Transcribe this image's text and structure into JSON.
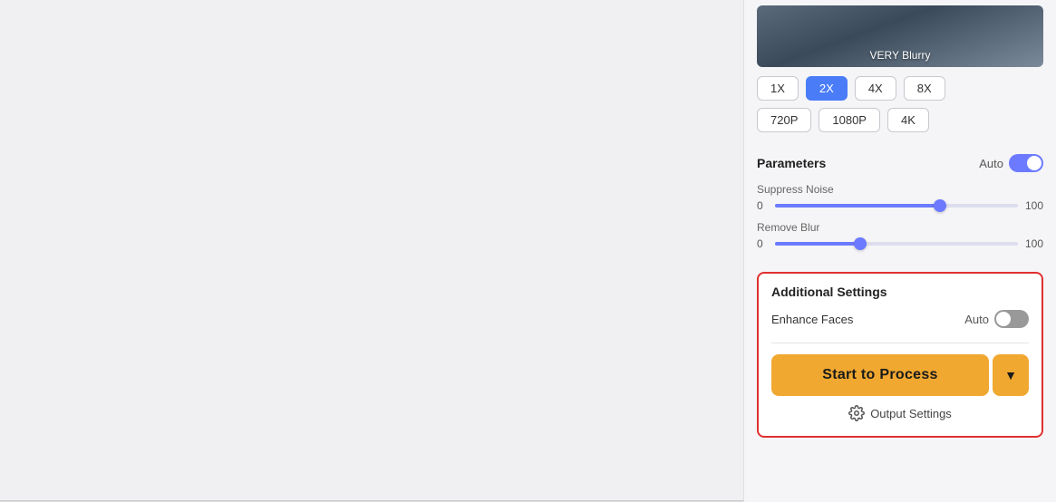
{
  "leftPanel": {
    "background": "#f0f0f2"
  },
  "rightPanel": {
    "imageThumb": {
      "label": "VERY Blurry"
    },
    "scaleButtons": {
      "row1": [
        "1X",
        "2X",
        "4X",
        "8X"
      ],
      "row2": [
        "720P",
        "1080P",
        "4K"
      ],
      "activeScale": "2X"
    },
    "parameters": {
      "title": "Parameters",
      "autoLabel": "Auto",
      "suppressNoise": {
        "label": "Suppress Noise",
        "min": 0,
        "max": 100,
        "value": 68,
        "fillPercent": 68
      },
      "removeBlur": {
        "label": "Remove Blur",
        "min": 0,
        "max": 100,
        "value": 35,
        "fillPercent": 35
      }
    },
    "additionalSettings": {
      "title": "Additional Settings",
      "enhanceFaces": {
        "label": "Enhance Faces",
        "autoLabel": "Auto"
      }
    },
    "processButton": {
      "label": "Start to Process",
      "dropdownArrow": "▼"
    },
    "outputSettings": {
      "label": "Output Settings"
    }
  }
}
